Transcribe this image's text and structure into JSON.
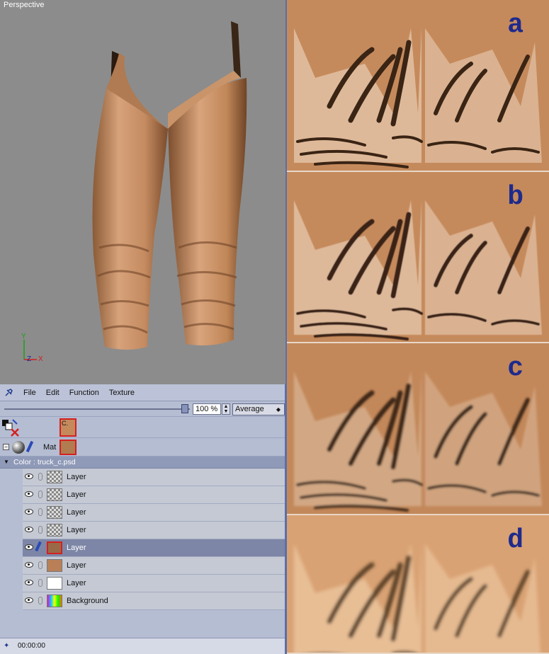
{
  "viewport": {
    "label": "Perspective",
    "axes": {
      "y": "Y",
      "z": "Z",
      "x": "X"
    }
  },
  "textures": [
    {
      "letter": "a"
    },
    {
      "letter": "b"
    },
    {
      "letter": "c"
    },
    {
      "letter": "d"
    }
  ],
  "menubar": {
    "items": [
      "File",
      "Edit",
      "Function",
      "Texture"
    ]
  },
  "toolbar": {
    "opacity": "100 %",
    "blend_mode": "Average",
    "opacity_fraction": 1.0
  },
  "material": {
    "swatch_label": "C.",
    "name": "Mat"
  },
  "channel": {
    "label": "Color : truck_c.psd"
  },
  "layers": [
    {
      "name": "Layer",
      "thumb": "checker",
      "selected": false
    },
    {
      "name": "Layer",
      "thumb": "checker",
      "selected": false
    },
    {
      "name": "Layer",
      "thumb": "checker",
      "selected": false
    },
    {
      "name": "Layer",
      "thumb": "checker",
      "selected": false
    },
    {
      "name": "Layer",
      "thumb": "sel",
      "selected": true
    },
    {
      "name": "Layer",
      "thumb": "brown",
      "selected": false
    },
    {
      "name": "Layer",
      "thumb": "white",
      "selected": false
    },
    {
      "name": "Background",
      "thumb": "bg",
      "selected": false
    }
  ],
  "timeline": {
    "time": "00:00:00"
  },
  "colors": {
    "texture_base": "#c58a5c",
    "letter": "#1e2a8c",
    "selection": "#d42020"
  }
}
